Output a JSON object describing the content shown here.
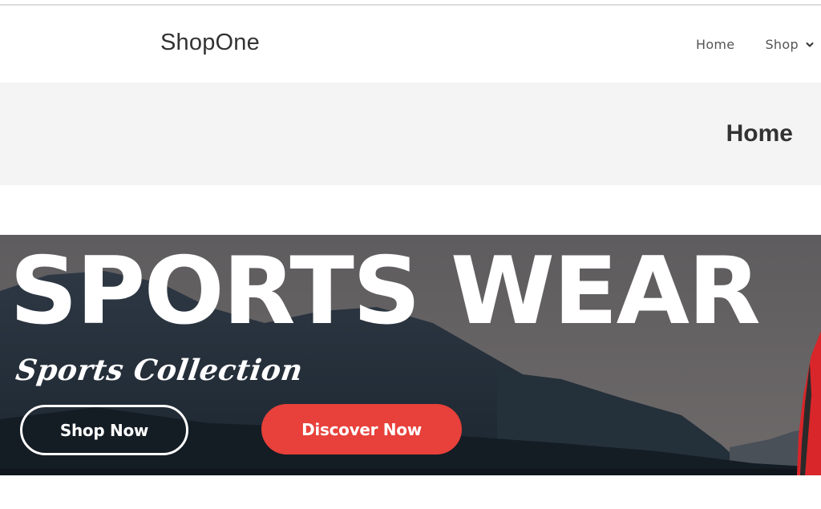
{
  "header": {
    "logo": "ShopOne",
    "nav": [
      {
        "label": "Home"
      },
      {
        "label": "Shop",
        "icon": "chevron-down-icon"
      }
    ]
  },
  "page_banner": {
    "title": "Home"
  },
  "hero": {
    "title": "SPORTS WEAR",
    "subtitle": "Sports Collection",
    "shop_now_label": "Shop Now",
    "discover_now_label": "Discover Now"
  },
  "colors": {
    "accent": "#e8403a",
    "banner_bg": "#f4f4f4",
    "text": "#333333"
  }
}
